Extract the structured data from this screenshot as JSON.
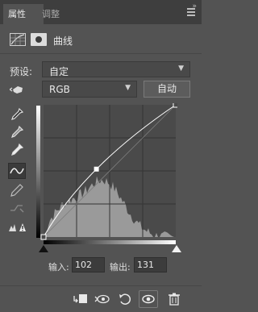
{
  "tabs": [
    {
      "label": "属性",
      "active": true
    },
    {
      "label": "调整",
      "active": false
    }
  ],
  "header": {
    "title": "曲线",
    "adjustment_icon": "curves-adjustment-icon",
    "mask_icon": "layer-mask-icon"
  },
  "preset": {
    "label": "预设:",
    "value": "自定"
  },
  "channel": {
    "value": "RGB",
    "auto_label": "自动"
  },
  "tools": [
    "on-image-adjust-hand-icon",
    "black-point-eyedropper-icon",
    "gray-point-eyedropper-icon",
    "white-point-eyedropper-icon",
    "curve-point-tool-icon",
    "pencil-draw-icon",
    "smooth-curve-icon",
    "clipping-warning-icon"
  ],
  "curve": {
    "input_label": "输入:",
    "input_value": "102",
    "output_label": "输出:",
    "output_value": "131",
    "points": [
      [
        0,
        0
      ],
      [
        102,
        131
      ],
      [
        255,
        255
      ]
    ],
    "selected_point": 1
  },
  "bottom_toolbar": [
    "clip-to-layer-icon",
    "view-previous-state-icon",
    "reset-icon",
    "visibility-eye-icon",
    "delete-trash-icon"
  ],
  "colors": {
    "panel_bg": "#535353",
    "graph_bg": "#4a4a4a",
    "histogram": "#9a9a9a",
    "curve": "#ffffff"
  }
}
